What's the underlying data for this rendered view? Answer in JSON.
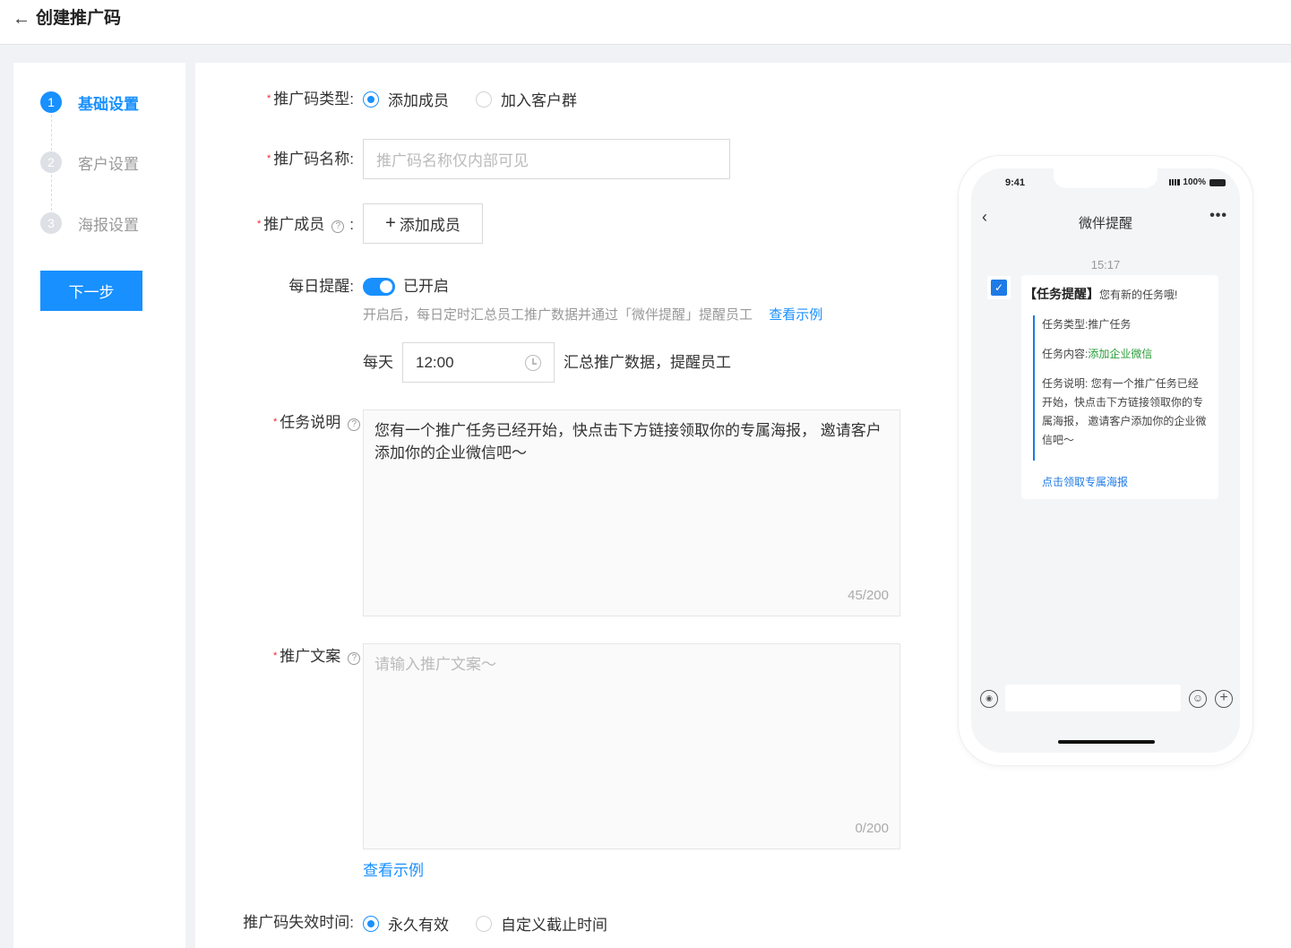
{
  "header": {
    "back_glyph": "←",
    "title": "创建推广码"
  },
  "steps": [
    {
      "num": "1",
      "label": "基础设置",
      "active": true
    },
    {
      "num": "2",
      "label": "客户设置",
      "active": false
    },
    {
      "num": "3",
      "label": "海报设置",
      "active": false
    }
  ],
  "next_button": "下一步",
  "form": {
    "type": {
      "label": "推广码类型:",
      "options": [
        "添加成员",
        "加入客户群"
      ],
      "selected": "添加成员"
    },
    "name": {
      "label": "推广码名称:",
      "placeholder": "推广码名称仅内部可见"
    },
    "members": {
      "label": "推广成员",
      "colon": ":",
      "add_button": "添加成员"
    },
    "daily": {
      "label": "每日提醒:",
      "switch_text": "已开启",
      "hint": "开启后，每日定时汇总员工推广数据并通过「微伴提醒」提醒员工",
      "hint_link": "查看示例",
      "prefix": "每天",
      "time": "12:00",
      "suffix": "汇总推广数据，提醒员工"
    },
    "task": {
      "label": "任务说明",
      "colon": ":",
      "value": "您有一个推广任务已经开始，快点击下方链接领取你的专属海报， 邀请客户添加你的企业微信吧～",
      "counter": "45/200"
    },
    "copy": {
      "label": "推广文案",
      "colon": ":",
      "placeholder": "请输入推广文案～",
      "counter": "0/200",
      "link": "查看示例"
    },
    "expire": {
      "label": "推广码失效时间:",
      "options": [
        "永久有效",
        "自定义截止时间"
      ],
      "selected": "永久有效"
    }
  },
  "phone": {
    "time": "9:41",
    "battery": "100%",
    "title": "微伴提醒",
    "more": "•••",
    "msg_time": "15:17",
    "card": {
      "title_bold": "【任务提醒】",
      "title_rest": "您有新的任务哦!",
      "type_label": "任务类型:",
      "type_value": "推广任务",
      "content_label": "任务内容:",
      "content_value": "添加企业微信",
      "desc_label": "任务说明:",
      "desc_value": "您有一个推广任务已经开始，快点击下方链接领取你的专属海报， 邀请客户添加你的企业微信吧～",
      "link": "点击领取专属海报"
    }
  },
  "colors": {
    "primary": "#1890ff",
    "required": "#f5222d",
    "green": "#2a9d39"
  }
}
